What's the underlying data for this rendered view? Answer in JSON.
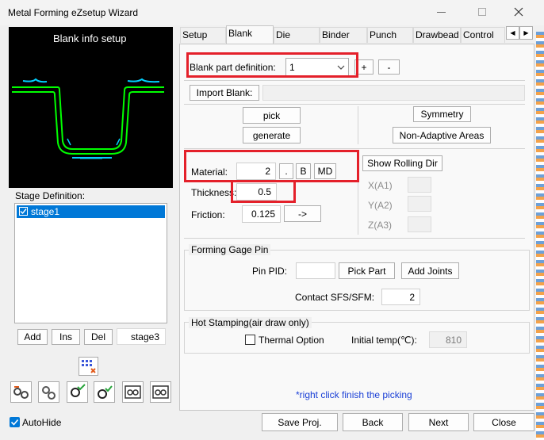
{
  "window": {
    "title": "Metal Forming eZsetup Wizard",
    "minimize_icon": "minimize-icon",
    "maximize_icon": "maximize-icon",
    "close_icon": "close-icon"
  },
  "preview": {
    "title": "Blank info setup"
  },
  "stage": {
    "label": "Stage Definition:",
    "items": [
      "stage1"
    ],
    "add_label": "Add",
    "ins_label": "Ins",
    "del_label": "Del",
    "stage_name": "stage3"
  },
  "autohide": {
    "label": "AutoHide",
    "checked": true
  },
  "tabs": [
    "Setup",
    "Blank",
    "Die",
    "Binder",
    "Punch",
    "Drawbead",
    "Control"
  ],
  "active_tab": "Blank",
  "blank": {
    "part_def_label": "Blank part definition:",
    "part_def_value": "1",
    "plus_label": "+",
    "minus_label": "-",
    "import_label": "Import Blank:",
    "pick_label": "pick",
    "generate_label": "generate",
    "symmetry_label": "Symmetry",
    "non_adaptive_label": "Non-Adaptive Areas",
    "material_label": "Material:",
    "material_value": "2",
    "dot_label": ".",
    "b_label": "B",
    "md_label": "MD",
    "show_rolling_label": "Show Rolling Dir",
    "thickness_label": "Thickness:",
    "thickness_value": "0.5",
    "friction_label": "Friction:",
    "friction_value": "0.125",
    "arrow_label": "->",
    "xa1_label": "X(A1)",
    "ya2_label": "Y(A2)",
    "za3_label": "Z(A3)"
  },
  "gage": {
    "title": "Forming Gage Pin",
    "pin_pid_label": "Pin PID:",
    "pick_part_label": "Pick Part",
    "add_joints_label": "Add Joints",
    "contact_label": "Contact SFS/SFM:",
    "contact_value": "2"
  },
  "hot": {
    "title": "Hot Stamping(air draw only)",
    "thermal_label": "Thermal Option",
    "initial_temp_label": "Initial temp(℃):",
    "initial_temp_value": "810"
  },
  "hint": "*right click finish the picking",
  "footer": {
    "save_label": "Save Proj.",
    "back_label": "Back",
    "next_label": "Next",
    "close_label": "Close"
  },
  "colors": {
    "accent": "#0078d7",
    "highlight": "#e4202a",
    "preview_bg": "#000000",
    "preview_green": "#00ff00",
    "preview_cyan": "#00d0ff",
    "hint_blue": "#1a3fd6"
  }
}
